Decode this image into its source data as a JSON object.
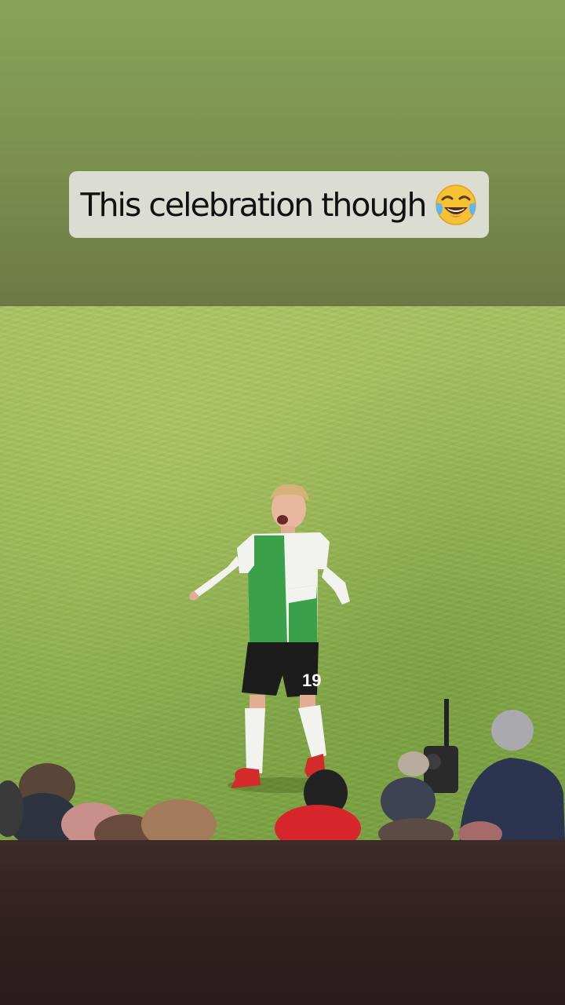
{
  "story": {
    "caption": "This celebration though",
    "caption_emoji": "face-with-tears-of-joy-icon"
  },
  "video": {
    "player_shirt_number": "19"
  },
  "colors": {
    "top_background": "#7d9350",
    "caption_background": "#dcddd2",
    "caption_text": "#111111",
    "pitch": "#98b855",
    "bottom_background": "#2f1f1f",
    "kit_green": "#3aa14a",
    "kit_white": "#f2f2ef",
    "boots_red": "#d32a2a"
  }
}
